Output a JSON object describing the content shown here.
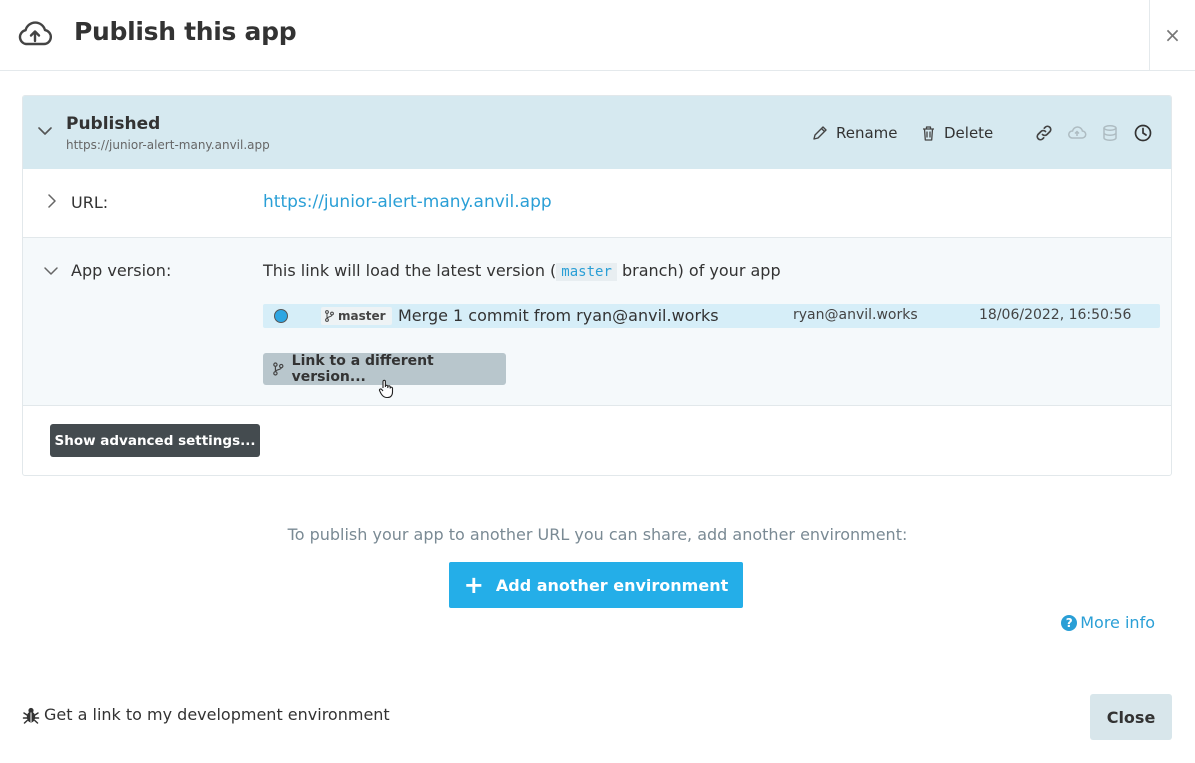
{
  "dialog": {
    "title": "Publish this app",
    "close_symbol": "×",
    "cloud_icon": "cloud-upload-icon"
  },
  "environment": {
    "name": "Published",
    "subtitle": "https://junior-alert-many.anvil.app",
    "actions": {
      "rename": "Rename",
      "delete": "Delete"
    },
    "icons": [
      "link-icon",
      "deploy-icon",
      "database-icon",
      "history-icon"
    ],
    "url_label": "URL:",
    "url_value": "https://junior-alert-many.anvil.app",
    "version_label": "App version:",
    "version_desc_pre": "This link will load the latest version (",
    "version_branch": "master",
    "version_desc_post": " branch) of your app",
    "commit": {
      "branch": "master",
      "message": "Merge 1 commit from ryan@anvil.works",
      "author": "ryan@anvil.works",
      "date": "18/06/2022, 16:50:56"
    },
    "link_version_label": "Link to a different version...",
    "advanced_label": "Show advanced settings..."
  },
  "footer": {
    "hint": "To publish your app to another URL you can share, add another environment:",
    "add_label": "Add another environment",
    "more_info": "More info",
    "dev_link": "Get a link to my development environment",
    "close_label": "Close"
  },
  "colors": {
    "accent": "#24aee8",
    "link": "#2a9fd6",
    "env_header_bg": "#d6e9f0",
    "commit_bg": "#d6eef8",
    "dark_button": "#444b4f"
  }
}
